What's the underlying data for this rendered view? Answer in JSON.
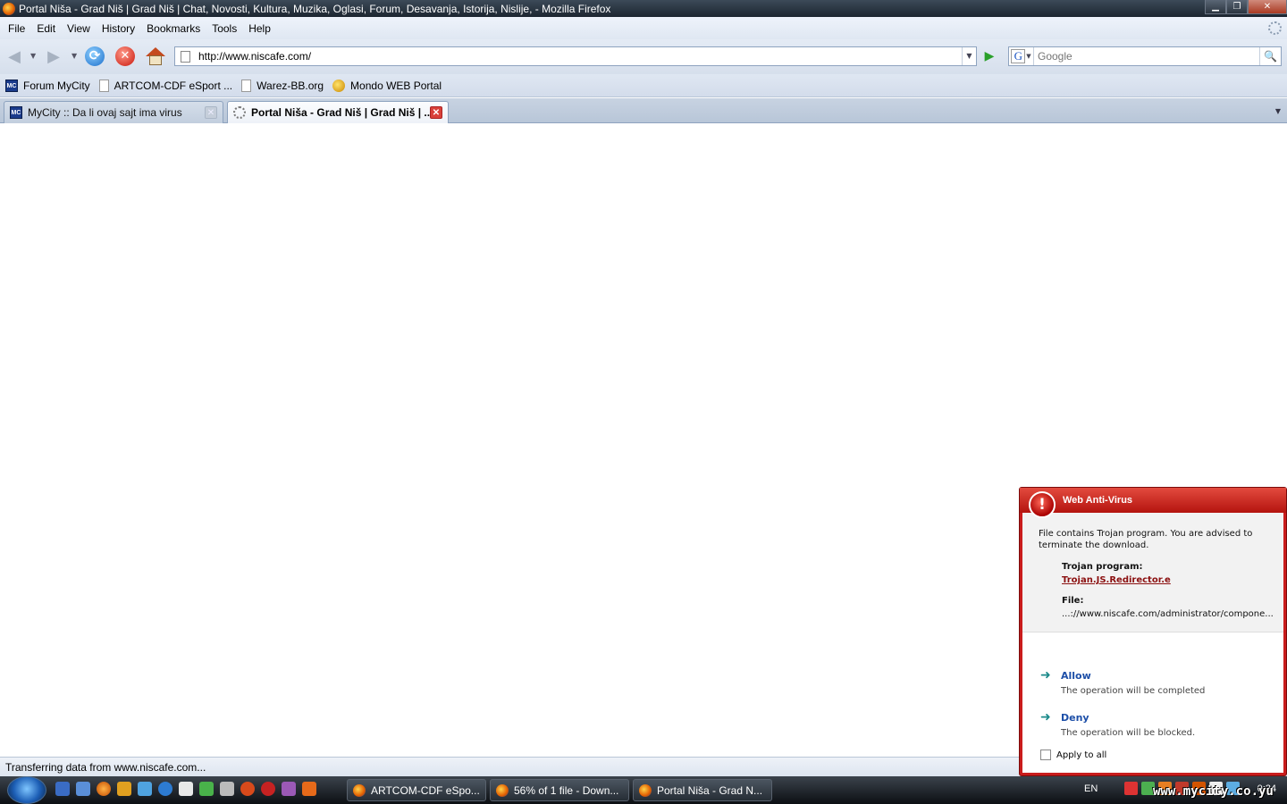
{
  "window": {
    "title": "Portal Niša - Grad Niš | Grad Niš | Chat, Novosti, Kultura, Muzika, Oglasi, Forum, Desavanja, Istorija, Nislije, - Mozilla Firefox",
    "minimize": "▁",
    "maximize": "❐",
    "close": "✕"
  },
  "menu": [
    "File",
    "Edit",
    "View",
    "History",
    "Bookmarks",
    "Tools",
    "Help"
  ],
  "nav": {
    "back": "◀",
    "forward": "▶",
    "reload": "⟳",
    "stop": "✕",
    "url": "http://www.niscafe.com/",
    "go": "▶",
    "search_placeholder": "Google",
    "search_engine": "G"
  },
  "bookmarks": [
    {
      "label": "Forum MyCity",
      "icon": "mycity-icon"
    },
    {
      "label": "ARTCOM-CDF eSport ...",
      "icon": "page-icon"
    },
    {
      "label": "Warez-BB.org",
      "icon": "page-icon"
    },
    {
      "label": "Mondo WEB Portal",
      "icon": "mondo-icon"
    }
  ],
  "tabs": [
    {
      "label": "MyCity :: Da li ovaj sajt ima virus",
      "close": "✕",
      "active": false
    },
    {
      "label": "Portal Niša - Grad Niš | Grad Niš | ...",
      "close": "✕",
      "active": true
    }
  ],
  "status": "Transferring data from www.niscafe.com...",
  "antivirus": {
    "title": "Web Anti-Virus",
    "warn_glyph": "!",
    "message": "File contains Trojan program. You are advised to terminate the download.",
    "trojan_label": "Trojan program:",
    "trojan_name": "Trojan.JS.Redirector.e",
    "file_label": "File:",
    "file_path": "...://www.niscafe.com/administrator/compone...",
    "actions": [
      {
        "name": "Allow",
        "desc": "The operation will be completed"
      },
      {
        "name": "Deny",
        "desc": "The operation will be blocked."
      }
    ],
    "apply_all": "Apply to all"
  },
  "taskbar": {
    "tasks": [
      {
        "label": "ARTCOM-CDF eSpo..."
      },
      {
        "label": "56% of 1 file - Down..."
      },
      {
        "label": "Portal Niša - Grad N..."
      }
    ],
    "language": "EN",
    "clock": "0:24",
    "watermark": "www.mycity.co.yu"
  },
  "colors": {
    "av_red": "#c91c1c",
    "link_blue": "#1d4fa8",
    "trojan_red": "#8b1010"
  }
}
